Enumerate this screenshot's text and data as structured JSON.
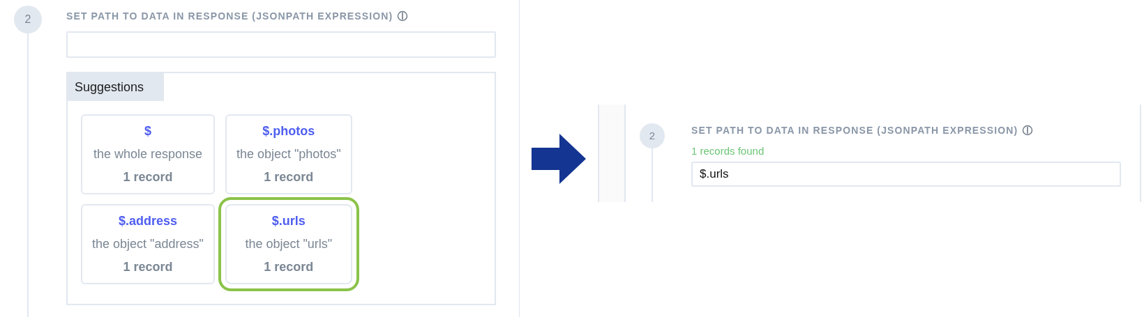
{
  "before": {
    "step": "2",
    "title": "SET PATH TO DATA IN RESPONSE (JSONPATH EXPRESSION)",
    "suggestions_label": "Suggestions",
    "suggestions": [
      {
        "path": "$",
        "description": "the whole response",
        "count": "1 record",
        "selected": false
      },
      {
        "path": "$.photos",
        "description": "the object \"photos\"",
        "count": "1 record",
        "selected": false
      },
      {
        "path": "$.address",
        "description": "the object \"address\"",
        "count": "1 record",
        "selected": false
      },
      {
        "path": "$.urls",
        "description": "the object \"urls\"",
        "count": "1 record",
        "selected": true
      }
    ]
  },
  "after": {
    "step": "2",
    "title": "SET PATH TO DATA IN RESPONSE (JSONPATH EXPRESSION)",
    "status": "1 records found",
    "input": {
      "value": "$.urls"
    }
  }
}
